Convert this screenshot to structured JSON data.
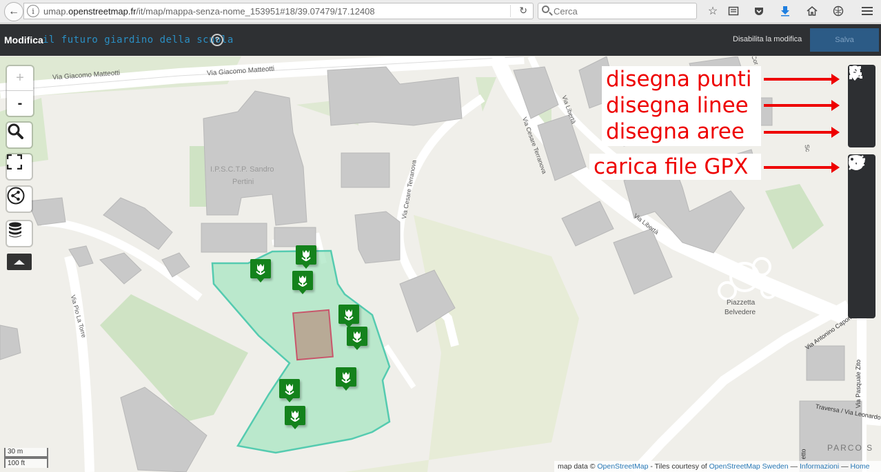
{
  "browser": {
    "url_prefix": "umap.",
    "url_host": "openstreetmap.fr",
    "url_path": "/it/map/mappa-senza-nome_153951#18/39.07479/17.12408",
    "search_placeholder": "Cerca"
  },
  "app": {
    "edit_label": "Modifica",
    "map_title": "il futuro giardino della scuola",
    "help_label": "?",
    "disable_edit_label": "Disabilita la modifica",
    "save_label": "Salva"
  },
  "map_controls": {
    "zoom_in": "+",
    "zoom_out": "-"
  },
  "annotations": {
    "draw_points": "disegna punti",
    "draw_lines": "disegna linee",
    "draw_areas": "disegna aree",
    "upload_gpx": "carica file GPX"
  },
  "map_labels": {
    "street_matteotti_1": "Via Giacomo Matteotti",
    "street_matteotti_2": "Via Giacomo Matteotti",
    "school_line1": "I.P.S.C.T.P. Sandro",
    "school_line2": "Pertini",
    "street_terranova_1": "Via Cesare Terranova",
    "street_terranova_2": "Via Cesare Terranova",
    "street_liberta_1": "Via Libertà",
    "street_liberta_2": "Via Libertà",
    "street_pio_la_torre": "Via Pio La Torre",
    "piazzetta_line1": "Piazzetta",
    "piazzetta_line2": "Belvedere",
    "street_caponnetto": "Via Antonino Caponnetto",
    "street_zito": "Via Pasquale Zito",
    "traversa": "Traversa / Via Leonardo Sciascia",
    "parco": "PARCO S",
    "street_corso": "Cor",
    "street_sc": "Sc",
    "street_etto": "etto"
  },
  "scale": {
    "metric": "30 m",
    "imperial": "100 ft"
  },
  "attribution": {
    "prefix": "map data ©",
    "osm": "OpenStreetMap",
    "tiles": "- Tiles courtesy of",
    "osm_sweden": "OpenStreetMap Sweden",
    "dash1": "—",
    "info": "Informazioni",
    "dash2": "—",
    "home": "Home"
  },
  "colors": {
    "appbar": "#2e3033",
    "title_accent": "#2a8fc4",
    "marker_green": "#14821c",
    "garden_fill": "#a8e6c2",
    "annotation_red": "#ee0000"
  },
  "icons": {
    "left": [
      "search-icon",
      "fullscreen-icon",
      "share-icon",
      "layers-data-icon"
    ],
    "right": [
      "marker-pin-icon",
      "polyline-icon",
      "polygon-icon",
      "upload-icon",
      "gear-icon",
      "tile-layers-icon",
      "datalayers-icon",
      "center-icon",
      "key-icon"
    ]
  }
}
